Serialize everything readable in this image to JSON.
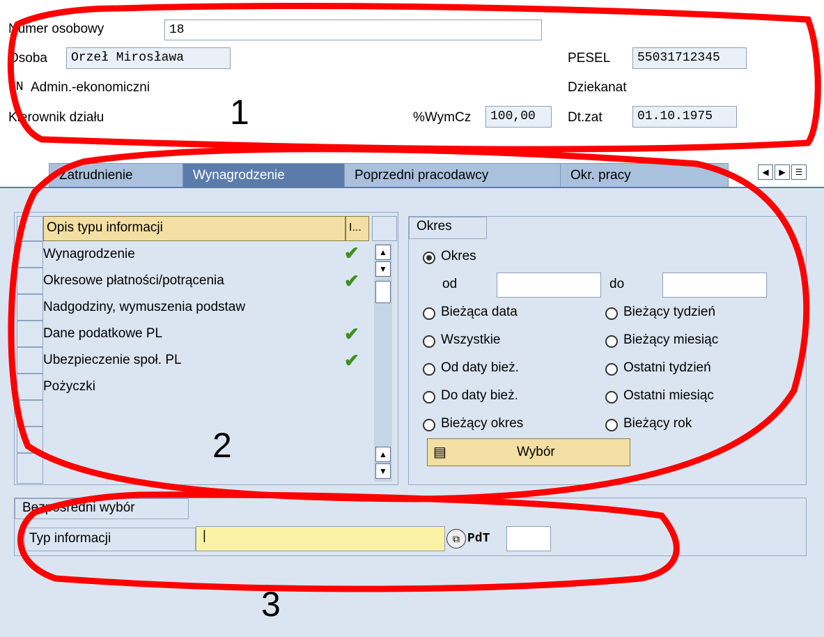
{
  "header": {
    "numer_label": "Numer osobowy",
    "numer_value": "18",
    "osoba_label": "Osoba",
    "osoba_value": "Orzeł Mirosława",
    "pesel_label": "PESEL",
    "pesel_value": "55031712345",
    "nn_label": "NN",
    "nn_value": "Admin.-ekonomiczni",
    "dziekanat": "Dziekanat",
    "kierownik": "Kierownik działu",
    "wymcz_label": "%WymCz",
    "wymcz_value": "100,00",
    "dtzat_label": "Dt.zat",
    "dtzat_value": "01.10.1975"
  },
  "tabs": [
    {
      "label": "Zatrudnienie"
    },
    {
      "label": "Wynagrodzenie"
    },
    {
      "label": "Poprzedni pracodawcy"
    },
    {
      "label": "Okr. pracy"
    }
  ],
  "table": {
    "header": "Opis typu informacji",
    "header_col2": "I...",
    "rows": [
      {
        "label": "Wynagrodzenie",
        "checked": true
      },
      {
        "label": "Okresowe płatności/potrącenia",
        "checked": true
      },
      {
        "label": "Nadgodziny, wymuszenia podstaw",
        "checked": false
      },
      {
        "label": "Dane podatkowe PL",
        "checked": true
      },
      {
        "label": "Ubezpieczenie społ. PL",
        "checked": true
      },
      {
        "label": "Pożyczki",
        "checked": false
      }
    ]
  },
  "okres": {
    "title": "Okres",
    "main_radio": "Okres",
    "od_label": "od",
    "do_label": "do",
    "options_left": [
      "Bieżąca data",
      "Wszystkie",
      "Od daty bież.",
      "Do daty bież.",
      "Bieżący okres"
    ],
    "options_right": [
      "Bieżący tydzień",
      "Bieżący miesiąc",
      "Ostatni tydzień",
      "Ostatni miesiąc",
      "Bieżący rok"
    ],
    "button": "Wybór"
  },
  "bezposredni": {
    "title": "Bezpośredni wybór",
    "typ_label": "Typ informacji",
    "pdt_label": "PdT"
  },
  "annotations": [
    "1",
    "2",
    "3"
  ]
}
